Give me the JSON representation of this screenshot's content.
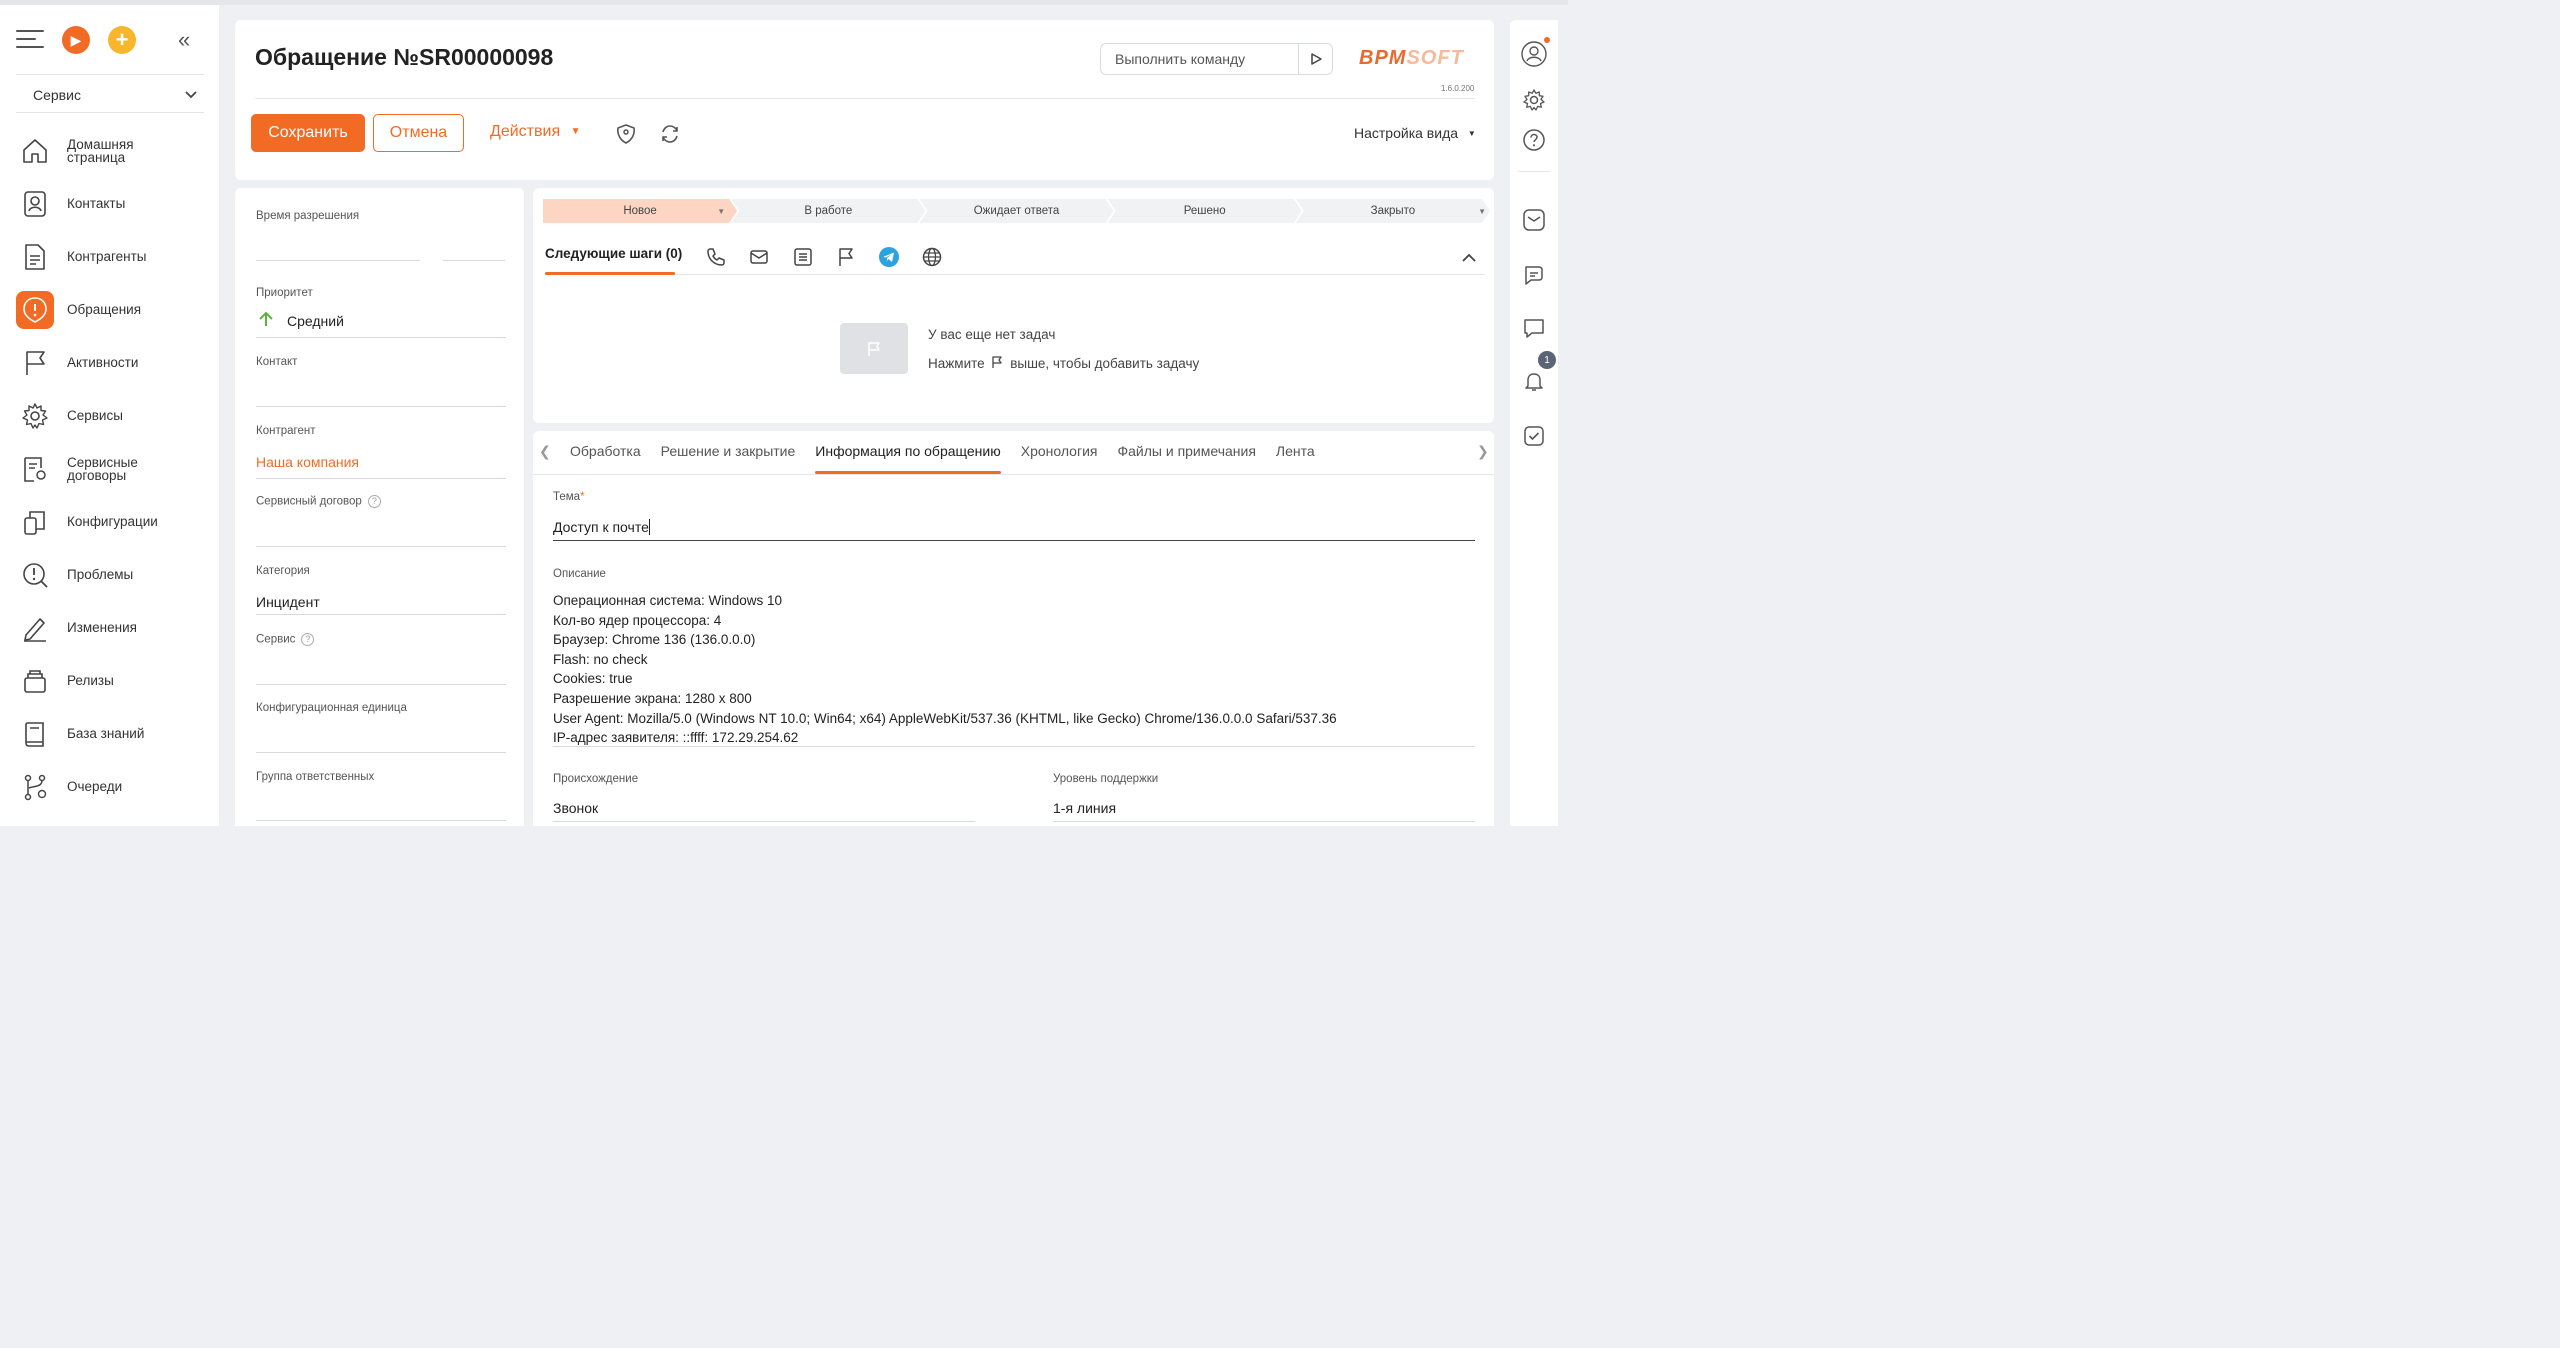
{
  "sidebar": {
    "workspace": "Сервис",
    "items": [
      {
        "label": "Домашняя\nстраница",
        "icon": "home-icon"
      },
      {
        "label": "Контакты",
        "icon": "contact-icon"
      },
      {
        "label": "Контрагенты",
        "icon": "document-icon"
      },
      {
        "label": "Обращения",
        "icon": "alert-icon",
        "active": true
      },
      {
        "label": "Активности",
        "icon": "flag-icon"
      },
      {
        "label": "Сервисы",
        "icon": "gear-icon"
      },
      {
        "label": "Сервисные\nдоговоры",
        "icon": "contract-icon"
      },
      {
        "label": "Конфигурации",
        "icon": "configuration-icon"
      },
      {
        "label": "Проблемы",
        "icon": "problem-icon"
      },
      {
        "label": "Изменения",
        "icon": "pen-icon"
      },
      {
        "label": "Релизы",
        "icon": "release-icon"
      },
      {
        "label": "База знаний",
        "icon": "book-icon"
      },
      {
        "label": "Очереди",
        "icon": "queue-icon"
      }
    ]
  },
  "header": {
    "title": "Обращение №SR00000098",
    "command_placeholder": "Выполнить команду",
    "logo_main": "BPM",
    "logo_accent": "SOFT",
    "version": "1.6.0.200",
    "save_label": "Сохранить",
    "cancel_label": "Отмена",
    "actions_label": "Действия",
    "view_settings_label": "Настройка вида"
  },
  "fields": {
    "resolution_time": {
      "label": "Время разрешения",
      "value": ""
    },
    "priority": {
      "label": "Приоритет",
      "value": "Средний"
    },
    "contact": {
      "label": "Контакт",
      "value": ""
    },
    "account": {
      "label": "Контрагент",
      "value": "Наша компания"
    },
    "service_contract": {
      "label": "Сервисный договор",
      "value": ""
    },
    "category": {
      "label": "Категория",
      "value": "Инцидент"
    },
    "service": {
      "label": "Сервис",
      "value": ""
    },
    "config_item": {
      "label": "Конфигурационная единица",
      "value": ""
    },
    "group": {
      "label": "Группа ответственных",
      "value": ""
    }
  },
  "stages": [
    "Новое",
    "В работе",
    "Ожидает ответа",
    "Решено",
    "Закрыто"
  ],
  "current_stage": 0,
  "next_steps": {
    "title": "Следующие шаги (0)",
    "empty_line1": "У вас еще нет задач",
    "empty_line2_prefix": "Нажмите",
    "empty_line2_suffix": "выше, чтобы добавить задачу"
  },
  "tabs": [
    "Обработка",
    "Решение и закрытие",
    "Информация по обращению",
    "Хронология",
    "Файлы и примечания",
    "Лента"
  ],
  "active_tab": 2,
  "details": {
    "subject": {
      "label": "Тема",
      "required_mark": "*",
      "value": "Доступ к почте"
    },
    "description": {
      "label": "Описание",
      "lines": [
        "Операционная система: Windows 10",
        "Кол-во ядер процессора: 4",
        "Браузер: Chrome 136 (136.0.0.0)",
        "Flash: no check",
        "Cookies: true",
        "Разрешение экрана: 1280 x 800",
        "User Agent: Mozilla/5.0 (Windows NT 10.0; Win64; x64) AppleWebKit/537.36 (KHTML, like Gecko) Chrome/136.0.0.0 Safari/537.36",
        "IP-адрес заявителя: ::ffff: 172.29.254.62"
      ]
    },
    "origin": {
      "label": "Происхождение",
      "value": "Звонок"
    },
    "support_level": {
      "label": "Уровень поддержки",
      "value": "1-я линия"
    }
  },
  "right_rail": {
    "notifications_count": "1"
  },
  "colors": {
    "accent": "#f26b25",
    "stage_current": "#fcd5c3",
    "telegram": "#2aa3e0"
  }
}
